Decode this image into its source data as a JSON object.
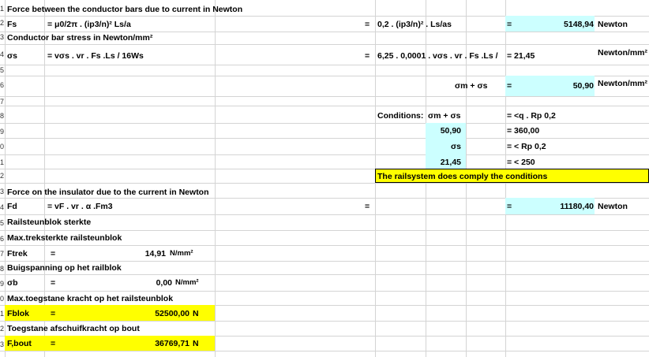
{
  "rows": {
    "r1_label": "Force between the conductor bars due to current in Newton",
    "r2_fs": "Fs",
    "r2_formula": "= μ0/2π . (ip3/n)² Ls/a",
    "r2_eq1": "=",
    "r2_expr": "0,2 . (ip3/n)² . Ls/as",
    "r2_eq2": "=",
    "r2_value": "5148,94",
    "r2_unit": "Newton",
    "r3_label": "Conductor bar stress in Newton/mm²",
    "r4_sigma": "σs",
    "r4_formula": "= vσs . vr .  Fs .Ls / 16Ws",
    "r4_eq1": "=",
    "r4_expr": "6,25 . 0,0001 . vσs . vr . Fs .Ls /",
    "r4_value": "= 21,45",
    "r4_unit": "Newton/mm²",
    "r6_expr": "σm + σs",
    "r6_eq": "=",
    "r6_value": "50,90",
    "r6_unit": "Newton/mm²",
    "cond_label": "Conditions:",
    "cond_expr": "σm + σs",
    "cond_eq1": "= <q . Rp 0,2",
    "cond_val1": "50,90",
    "cond_eq2": "= 360,00",
    "cond_sigma": "σs",
    "cond_eq3": "= < Rp 0,2",
    "cond_val2": "21,45",
    "cond_eq4": "= < 250",
    "comply": "The railsystem does comply the conditions",
    "ins_label": "Force on the insulator due to the current in Newton",
    "fd_label": "Fd",
    "fd_formula": "= vF . vr . α .Fm3",
    "fd_eq1": "=",
    "fd_eq2": "=",
    "fd_value": "11180,40",
    "fd_unit": "Newton",
    "rail_label": "Railsteunblok sterkte",
    "max_label": "Max.treksterkte railsteunblok",
    "ftrek_label": "Ftrek",
    "ftrek_eq": "=",
    "ftrek_value": "14,91",
    "ftrek_unit": "N/mm²",
    "buig_label": "Buigspanning op het railblok",
    "sb_label": "σb",
    "sb_eq": "=",
    "sb_value": "0,00",
    "sb_unit": "N/mm²",
    "maxkr_label": "Max.toegstane kracht op het railsteunblok",
    "fblok_label": "Fblok",
    "fblok_eq": "=",
    "fblok_value": "52500,00",
    "fblok_unit": "N",
    "toeg_label": "Toegstane afschuifkracht op bout",
    "fbout_label": "F,bout",
    "fbout_eq": "=",
    "fbout_value": "36769,71",
    "fbout_unit": "N"
  },
  "row_numbers": [
    "1",
    "2",
    "3",
    "4",
    "5",
    "6",
    "7",
    "8",
    "9",
    "0",
    "1",
    "2",
    "3",
    "4",
    "5",
    "6",
    "7",
    "8",
    "9",
    "0",
    "1",
    "2",
    "3"
  ],
  "colors": {
    "cyan": "#ccffff",
    "yellow": "#ffff00",
    "grid": "#d4d4d4"
  }
}
